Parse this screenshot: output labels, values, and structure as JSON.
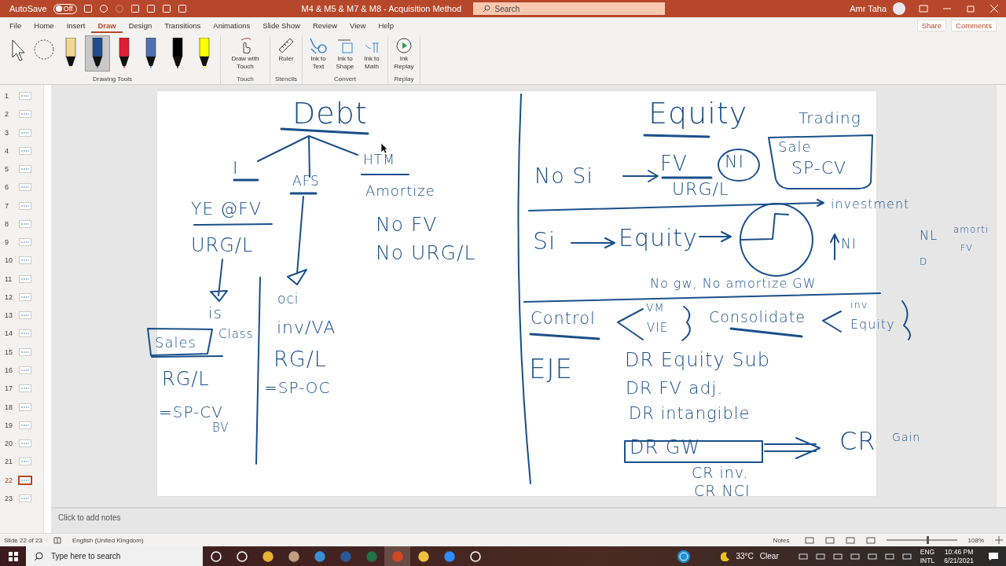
{
  "title_bar": {
    "autosave_label": "AutoSave",
    "autosave_state": "Off",
    "autosave_on": false,
    "document_title": "M4 & M5 & M7 & M8 - Acquisition Method",
    "search_placeholder": "Search",
    "user_name": "Amr Taha"
  },
  "tabs": [
    {
      "label": "File",
      "selected": false
    },
    {
      "label": "Home",
      "selected": false
    },
    {
      "label": "Insert",
      "selected": false
    },
    {
      "label": "Draw",
      "selected": true
    },
    {
      "label": "Design",
      "selected": false
    },
    {
      "label": "Transitions",
      "selected": false
    },
    {
      "label": "Animations",
      "selected": false
    },
    {
      "label": "Slide Show",
      "selected": false
    },
    {
      "label": "Review",
      "selected": false
    },
    {
      "label": "View",
      "selected": false
    },
    {
      "label": "Help",
      "selected": false
    }
  ],
  "share_button": "Share",
  "comments_button": "Comments",
  "ribbon": {
    "pens": [
      {
        "color": "#f0d890",
        "selected": false
      },
      {
        "color": "#1f4e8c",
        "selected": true
      },
      {
        "color": "#e02030",
        "selected": false
      },
      {
        "color": "#5070b0",
        "selected": false
      },
      {
        "color": "#000000",
        "selected": false
      },
      {
        "color": "#ffff00",
        "selected": false
      }
    ],
    "groups": [
      {
        "label": "Drawing Tools"
      },
      {
        "label": "Touch",
        "buttons": [
          {
            "kind": "touch",
            "label": "Draw with Touch"
          }
        ]
      },
      {
        "label": "Stencils",
        "buttons": [
          {
            "kind": "ruler",
            "label": "Ruler"
          }
        ]
      },
      {
        "label": "Convert",
        "buttons": [
          {
            "kind": "text",
            "label": "Ink to Text"
          },
          {
            "kind": "shape",
            "label": "Ink to Shape"
          },
          {
            "kind": "math",
            "label": "Ink to Math"
          }
        ]
      },
      {
        "label": "Replay",
        "buttons": [
          {
            "kind": "replay",
            "label": "Ink Replay"
          }
        ]
      }
    ]
  },
  "thumbnails": [
    {
      "number": "1",
      "selected": false
    },
    {
      "number": "2",
      "selected": false
    },
    {
      "number": "3",
      "selected": false
    },
    {
      "number": "4",
      "selected": false
    },
    {
      "number": "5",
      "selected": false
    },
    {
      "number": "6",
      "selected": false
    },
    {
      "number": "7",
      "selected": false
    },
    {
      "number": "8",
      "selected": false
    },
    {
      "number": "9",
      "selected": false
    },
    {
      "number": "10",
      "selected": false
    },
    {
      "number": "11",
      "selected": false
    },
    {
      "number": "12",
      "selected": false
    },
    {
      "number": "13",
      "selected": false
    },
    {
      "number": "14",
      "selected": false
    },
    {
      "number": "15",
      "selected": false
    },
    {
      "number": "16",
      "selected": false
    },
    {
      "number": "17",
      "selected": false
    },
    {
      "number": "18",
      "selected": false
    },
    {
      "number": "19",
      "selected": false
    },
    {
      "number": "20",
      "selected": false
    },
    {
      "number": "21",
      "selected": false
    },
    {
      "number": "22",
      "selected": true
    },
    {
      "number": "23",
      "selected": false
    }
  ],
  "slide": {
    "ink": [
      {
        "text": "Debt"
      },
      {
        "text": "I"
      },
      {
        "text": "AFS"
      },
      {
        "text": "HTM"
      },
      {
        "text": "Amortize"
      },
      {
        "text": "YE @FV"
      },
      {
        "text": "URG/L"
      },
      {
        "text": "No FV"
      },
      {
        "text": "No URG/L"
      },
      {
        "text": "is"
      },
      {
        "text": "Sales"
      },
      {
        "text": "Class"
      },
      {
        "text": "oci"
      },
      {
        "text": "inv/VA"
      },
      {
        "text": "RG/L"
      },
      {
        "text": "=SP-OC"
      },
      {
        "text": "RG/L"
      },
      {
        "text": "=SP-CV"
      },
      {
        "text": "BV"
      },
      {
        "text": "Equity"
      },
      {
        "text": "Trading"
      },
      {
        "text": "Sale"
      },
      {
        "text": "SP-CV"
      },
      {
        "text": "No Si"
      },
      {
        "text": "FV"
      },
      {
        "text": "NI"
      },
      {
        "text": "URG/L"
      },
      {
        "text": "investment"
      },
      {
        "text": "Si"
      },
      {
        "text": "Equity"
      },
      {
        "text": "NI"
      },
      {
        "text": "NL"
      },
      {
        "text": "amorti"
      },
      {
        "text": "FV"
      },
      {
        "text": "D"
      },
      {
        "text": "No gw, No amortize GW"
      },
      {
        "text": "Control"
      },
      {
        "text": "VM"
      },
      {
        "text": "VIE"
      },
      {
        "text": "Consolidate"
      },
      {
        "text": "inv"
      },
      {
        "text": "Equity"
      },
      {
        "text": "EJE"
      },
      {
        "text": "DR Equity Sub"
      },
      {
        "text": "DR FV adj."
      },
      {
        "text": "DR intangible"
      },
      {
        "text": "DR GW"
      },
      {
        "text": "CR"
      },
      {
        "text": "Gain"
      },
      {
        "text": "CR inv."
      },
      {
        "text": "CR NCI"
      }
    ]
  },
  "notes_placeholder": "Click to add notes",
  "status_bar": {
    "slide_counter": "Slide 22 of 23",
    "language": "English (United Kingdom)",
    "notes_button": "Notes",
    "zoom": {
      "level": 0.57
    },
    "zoom_value": "108%"
  },
  "taskbar": {
    "search_placeholder": "Type here to search",
    "weather": "33°C",
    "weather_text": "Clear",
    "lang_1": "ENG",
    "lang_2": "INTL",
    "time": "10:46 PM",
    "date": "6/21/2021"
  }
}
